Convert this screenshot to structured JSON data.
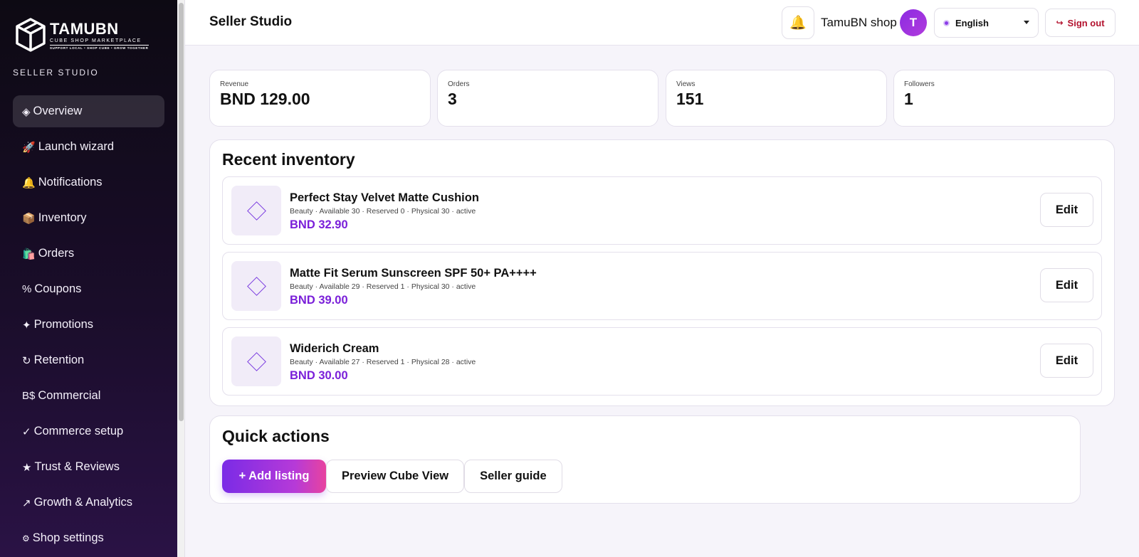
{
  "brand": {
    "name": "TAMUBN",
    "subtitle": "CUBE SHOP MARKETPLACE",
    "tagline": "SUPPORT LOCAL • SHOP CUBE • GROW TOGETHER",
    "section_label": "SELLER STUDIO"
  },
  "sidebar": {
    "items": [
      {
        "icon": "◈",
        "label": "Overview",
        "active": true
      },
      {
        "icon": "🚀",
        "label": "Launch wizard"
      },
      {
        "icon": "🔔",
        "label": "Notifications"
      },
      {
        "icon": "📦",
        "label": "Inventory"
      },
      {
        "icon": "🛍️",
        "label": "Orders"
      },
      {
        "icon": "%",
        "label": "Coupons"
      },
      {
        "icon": "✦",
        "label": "Promotions"
      },
      {
        "icon": "↻",
        "label": "Retention"
      },
      {
        "icon": "B$",
        "label": "Commercial"
      },
      {
        "icon": "✓",
        "label": "Commerce setup"
      },
      {
        "icon": "★",
        "label": "Trust & Reviews"
      },
      {
        "icon": "↗",
        "label": "Growth & Analytics"
      },
      {
        "icon": "⚙",
        "label": "Shop settings"
      }
    ]
  },
  "header": {
    "title": "Seller Studio",
    "bell_icon": "🔔",
    "shop_name": "TamuBN shop",
    "avatar_initial": "T",
    "language": "English",
    "sign_out_icon": "↪",
    "sign_out_label": "Sign out"
  },
  "stats": [
    {
      "label": "Revenue",
      "value": "BND 129.00"
    },
    {
      "label": "Orders",
      "value": "3"
    },
    {
      "label": "Views",
      "value": "151"
    },
    {
      "label": "Followers",
      "value": "1"
    }
  ],
  "inventory": {
    "title": "Recent inventory",
    "edit_label": "Edit",
    "items": [
      {
        "name": "Perfect Stay Velvet Matte Cushion",
        "meta": "Beauty · Available 30 · Reserved 0 · Physical 30 · active",
        "price": "BND 32.90"
      },
      {
        "name": "Matte Fit Serum Sunscreen SPF 50+ PA++++",
        "meta": "Beauty · Available 29 · Reserved 1 · Physical 30 · active",
        "price": "BND 39.00"
      },
      {
        "name": "Widerich Cream",
        "meta": "Beauty · Available 27 · Reserved 1 · Physical 28 · active",
        "price": "BND 30.00"
      }
    ]
  },
  "quick_actions": {
    "title": "Quick actions",
    "add_listing": "+ Add listing",
    "preview": "Preview Cube View",
    "guide": "Seller guide"
  }
}
